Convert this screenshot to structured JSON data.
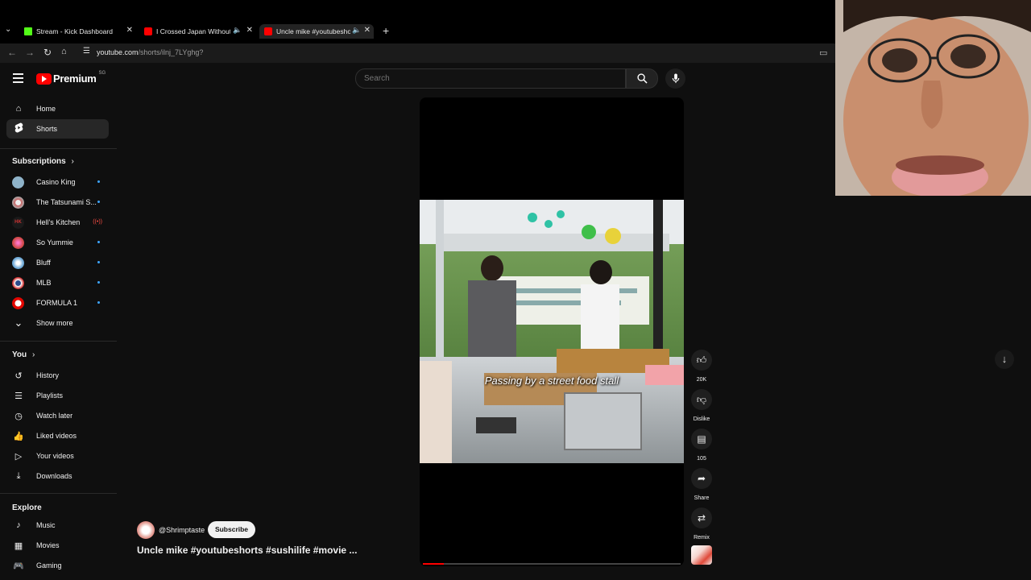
{
  "browser": {
    "tabs": [
      {
        "title": "Stream - Kick Dashboard",
        "favicon": "kick-icon",
        "color": "#53fc18"
      },
      {
        "title": "I Crossed Japan Without a I",
        "favicon": "youtube-icon",
        "color": "#ff0000"
      },
      {
        "title": "Uncle mike #youtubeshorts",
        "favicon": "youtube-icon",
        "color": "#ff0000"
      }
    ],
    "url_host": "youtube.com",
    "url_path": "/shorts/ilnj_7LYghg?"
  },
  "header": {
    "logo_text": "Premium",
    "logo_country": "SG",
    "search_placeholder": "Search"
  },
  "sidebar": {
    "main": [
      {
        "label": "Home",
        "icon": "home-icon"
      },
      {
        "label": "Shorts",
        "icon": "shorts-icon",
        "selected": true
      }
    ],
    "subscriptions_title": "Subscriptions",
    "subscriptions": [
      {
        "label": "Casino King",
        "color": "#8fb3c9"
      },
      {
        "label": "The Tatsunami S...",
        "color": "#c9c9c9"
      },
      {
        "label": "Hell's Kitchen",
        "color": "#2a2a2a",
        "avatar_text": "HK"
      },
      {
        "label": "So Yummie",
        "color": "#d14a4a"
      },
      {
        "label": "Bluff",
        "color": "#6da8d6"
      },
      {
        "label": "MLB",
        "color": "#ffffff"
      },
      {
        "label": "FORMULA 1",
        "color": "#e10600"
      }
    ],
    "show_more": "Show more",
    "you_title": "You",
    "you": [
      {
        "label": "History",
        "icon": "history-icon"
      },
      {
        "label": "Playlists",
        "icon": "playlists-icon"
      },
      {
        "label": "Watch later",
        "icon": "watch-later-icon"
      },
      {
        "label": "Liked videos",
        "icon": "like-icon"
      },
      {
        "label": "Your videos",
        "icon": "your-videos-icon"
      },
      {
        "label": "Downloads",
        "icon": "download-icon"
      }
    ],
    "explore_title": "Explore",
    "explore": [
      {
        "label": "Music",
        "icon": "music-icon"
      },
      {
        "label": "Movies",
        "icon": "movies-icon"
      },
      {
        "label": "Gaming",
        "icon": "gaming-icon"
      }
    ]
  },
  "short": {
    "caption": "Passing by a street food stall",
    "progress": 0.08,
    "channel": "@Shrimptaste",
    "subscribe": "Subscribe",
    "title": "Uncle mike #youtubeshorts #sushilife #movie ...",
    "actions": {
      "likes": "20K",
      "dislike": "Dislike",
      "comments": "105",
      "share": "Share",
      "remix": "Remix"
    }
  }
}
